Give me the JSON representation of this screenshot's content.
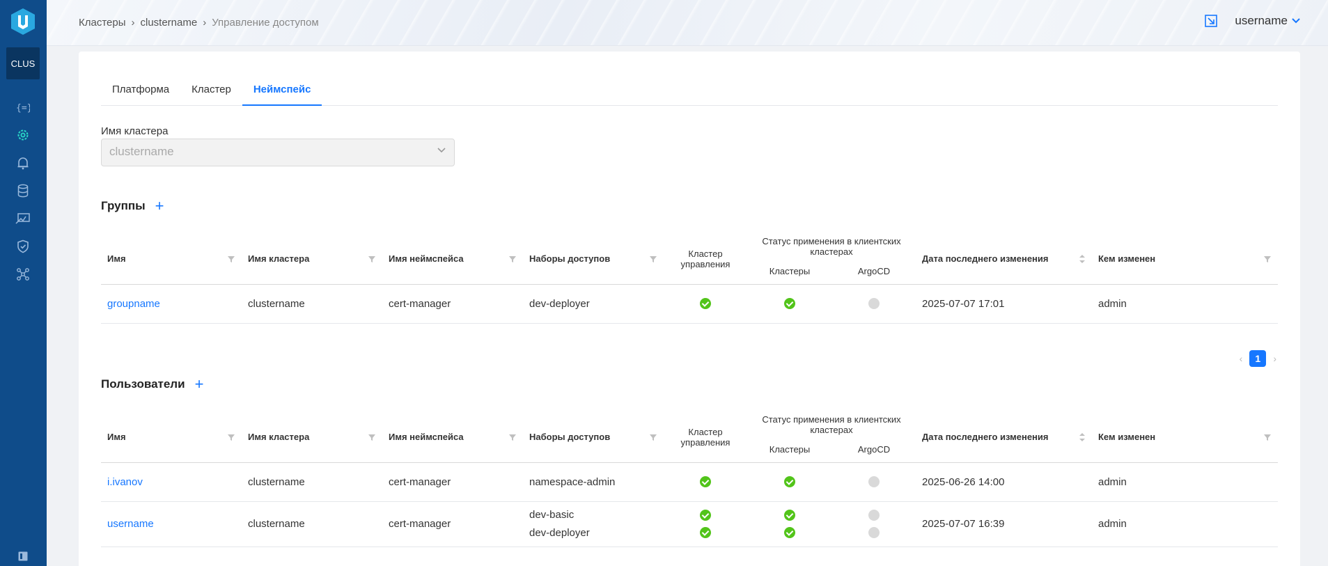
{
  "sidebar": {
    "cluster_badge": "CLUS",
    "icons": [
      "code-brackets-icon",
      "settings-gear-icon",
      "bell-icon",
      "database-icon",
      "deploy-icon",
      "shield-icon",
      "network-icon"
    ],
    "active_icon": "settings-gear-icon",
    "accent_color": "#2ad8c8"
  },
  "header": {
    "breadcrumbs": [
      "Кластеры",
      "clustername",
      "Управление доступом"
    ],
    "username": "username"
  },
  "tabs": [
    {
      "label": "Платформа",
      "active": false
    },
    {
      "label": "Кластер",
      "active": false
    },
    {
      "label": "Неймспейс",
      "active": true
    }
  ],
  "cluster_field": {
    "label": "Имя кластера",
    "value": "clustername"
  },
  "columns": {
    "name": "Имя",
    "cluster_name": "Имя кластера",
    "namespace_name": "Имя неймспейса",
    "access_sets": "Наборы доступов",
    "mgmt_cluster": "Кластер управления",
    "apply_status": "Статус применения в клиентских кластерах",
    "clusters": "Кластеры",
    "argocd": "ArgoCD",
    "last_modified": "Дата последнего изменения",
    "modified_by": "Кем изменен"
  },
  "groups": {
    "title": "Группы",
    "rows": [
      {
        "name": "groupname",
        "cluster": "clustername",
        "namespace": "cert-manager",
        "access_sets": [
          "dev-deployer"
        ],
        "mgmt": [
          "ok"
        ],
        "clusters": [
          "ok"
        ],
        "argocd": [
          "none"
        ],
        "date": "2025-07-07 17:01",
        "by": "admin"
      }
    ],
    "page": "1"
  },
  "users": {
    "title": "Пользователи",
    "rows": [
      {
        "name": "i.ivanov",
        "cluster": "clustername",
        "namespace": "cert-manager",
        "access_sets": [
          "namespace-admin"
        ],
        "mgmt": [
          "ok"
        ],
        "clusters": [
          "ok"
        ],
        "argocd": [
          "none"
        ],
        "date": "2025-06-26 14:00",
        "by": "admin"
      },
      {
        "name": "username",
        "cluster": "clustername",
        "namespace": "cert-manager",
        "access_sets": [
          "dev-basic",
          "dev-deployer"
        ],
        "mgmt": [
          "ok",
          "ok"
        ],
        "clusters": [
          "ok",
          "ok"
        ],
        "argocd": [
          "none",
          "none"
        ],
        "date": "2025-07-07 16:39",
        "by": "admin"
      }
    ]
  }
}
